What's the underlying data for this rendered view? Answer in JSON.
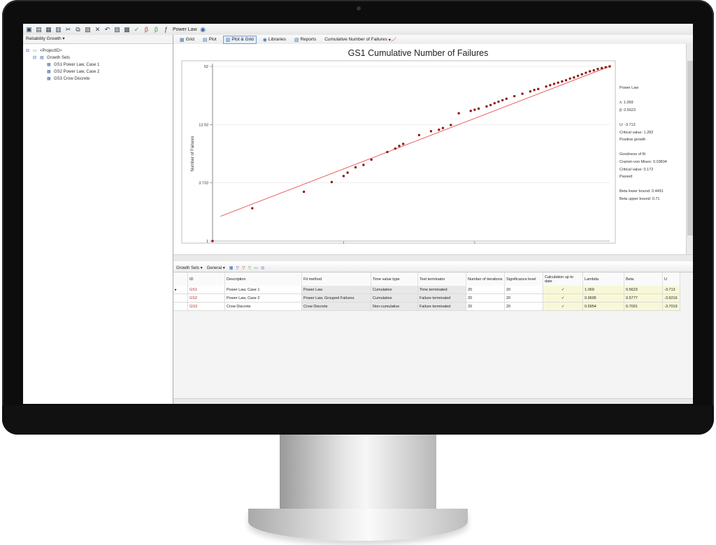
{
  "toolbar": {
    "dropdown_label": "Power Law"
  },
  "left_panel": {
    "header": "Reliability Growth",
    "tree": [
      {
        "label": "<ProjectID>"
      },
      {
        "label": "Growth Sets"
      },
      {
        "label": "GS1 Power Law, Case 1"
      },
      {
        "label": "GS2 Power Law, Case 2"
      },
      {
        "label": "GS3 Crow Discrete"
      }
    ]
  },
  "plot_toolbar": {
    "grid": "Grid",
    "plot": "Plot",
    "plot_grid": "Plot & Grid",
    "libraries": "Libraries",
    "reports": "Reports",
    "plot_type": "Cumulative Number of Failures"
  },
  "chart_data": {
    "type": "scatter",
    "title": "GS1 Cumulative Number of Failures",
    "ylabel": "Number of Failures",
    "xlabel": "",
    "y_scale": "log",
    "y_ticks": [
      "1",
      "3.733",
      "13.93",
      "52"
    ],
    "ylim": [
      1,
      52
    ],
    "grid": true,
    "fit_line": {
      "from": [
        0.02,
        1.75
      ],
      "to": [
        1.0,
        52
      ]
    },
    "points": [
      [
        0.1,
        2.1
      ],
      [
        0.23,
        3.05
      ],
      [
        0.3,
        3.8
      ],
      [
        0.33,
        4.35
      ],
      [
        0.34,
        4.7
      ],
      [
        0.36,
        5.3
      ],
      [
        0.38,
        5.6
      ],
      [
        0.4,
        6.3
      ],
      [
        0.44,
        7.5
      ],
      [
        0.46,
        8.1
      ],
      [
        0.47,
        8.6
      ],
      [
        0.48,
        9.0
      ],
      [
        0.52,
        11.0
      ],
      [
        0.55,
        12.0
      ],
      [
        0.57,
        12.4
      ],
      [
        0.58,
        12.9
      ],
      [
        0.6,
        13.8
      ],
      [
        0.62,
        18.0
      ],
      [
        0.65,
        19.0
      ],
      [
        0.66,
        19.5
      ],
      [
        0.67,
        20.0
      ],
      [
        0.69,
        21.0
      ],
      [
        0.7,
        21.7
      ],
      [
        0.71,
        22.6
      ],
      [
        0.72,
        23.4
      ],
      [
        0.73,
        24.2
      ],
      [
        0.74,
        25.0
      ],
      [
        0.76,
        26.5
      ],
      [
        0.78,
        28.0
      ],
      [
        0.8,
        29.5
      ],
      [
        0.81,
        30.5
      ],
      [
        0.82,
        31.2
      ],
      [
        0.84,
        33.0
      ],
      [
        0.85,
        34.0
      ],
      [
        0.86,
        35.0
      ],
      [
        0.87,
        36.0
      ],
      [
        0.88,
        37.0
      ],
      [
        0.89,
        38.0
      ],
      [
        0.9,
        39.5
      ],
      [
        0.91,
        40.5
      ],
      [
        0.92,
        42.0
      ],
      [
        0.93,
        43.5
      ],
      [
        0.94,
        45.0
      ],
      [
        0.95,
        46.5
      ],
      [
        0.96,
        47.5
      ],
      [
        0.97,
        49.0
      ],
      [
        0.98,
        50.0
      ],
      [
        0.99,
        51.0
      ],
      [
        1.0,
        52.0
      ]
    ],
    "colors": {
      "points": "#8b1a1a",
      "fit": "#e32020"
    }
  },
  "side_info": [
    "Power Law",
    "",
    "λ: 1.069",
    "β: 0.5623",
    "",
    "U: -3.713",
    "Critical value: 1.282",
    "Positive growth",
    "",
    "Goodness of fit",
    "Cramér-von Mises: 0.03834",
    "Critical value: 0.172",
    "Passed",
    "",
    "Beta lower bound: 0.4491",
    "Beta upper bound: 0.71"
  ],
  "grid_bar": {
    "sets_label": "Growth Sets",
    "general_label": "General"
  },
  "table": {
    "columns": [
      "ID",
      "Description",
      "Fit method",
      "Time value type",
      "Test terminator",
      "Number of iterations",
      "Significance level",
      "Calculation up to date",
      "Lambda",
      "Beta",
      "U"
    ],
    "rows": [
      [
        "GS1",
        "Power Law, Case 1",
        "Power Law",
        "Cumulative",
        "Time terminated",
        "20",
        "20",
        "✓",
        "1.069",
        "0.5623",
        "-3.713"
      ],
      [
        "GS2",
        "Power Law, Case 2",
        "Power Law, Grouped Failures",
        "Cumulative",
        "Failure terminated",
        "20",
        "20",
        "✓",
        "0.9695",
        "0.5777",
        "-3.9216"
      ],
      [
        "GS3",
        "Crow Discrete",
        "Crow Discrete",
        "Non-cumulative",
        "Failure terminated",
        "20",
        "20",
        "✓",
        "0.5954",
        "0.7001",
        "-3.7019"
      ]
    ]
  }
}
